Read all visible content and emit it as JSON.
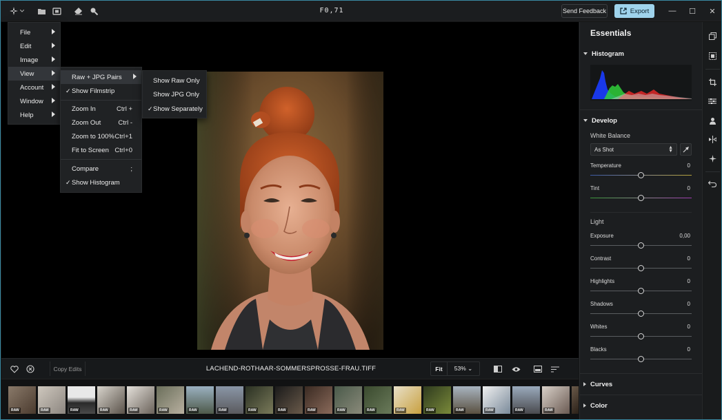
{
  "titlebar": {
    "title": "F0,71",
    "feedback_label": "Send Feedback",
    "export_label": "Export",
    "icons": [
      "app-logo-icon",
      "folder-icon",
      "import-icon",
      "eraser-icon",
      "search-icon"
    ],
    "window_controls": {
      "minimize": "—",
      "maximize": "☐",
      "close": "✕"
    }
  },
  "main_menu": {
    "items": [
      {
        "label": "File"
      },
      {
        "label": "Edit"
      },
      {
        "label": "Image"
      },
      {
        "label": "View"
      },
      {
        "label": "Account"
      },
      {
        "label": "Window"
      },
      {
        "label": "Help"
      }
    ]
  },
  "view_menu": {
    "raw_jpg": "Raw + JPG Pairs",
    "show_filmstrip": "Show Filmstrip",
    "zoom_in": {
      "label": "Zoom In",
      "shortcut": "Ctrl +"
    },
    "zoom_out": {
      "label": "Zoom Out",
      "shortcut": "Ctrl -"
    },
    "zoom_100": {
      "label": "Zoom to 100%",
      "shortcut": "Ctrl+1"
    },
    "fit_screen": {
      "label": "Fit to Screen",
      "shortcut": "Ctrl+0"
    },
    "compare": {
      "label": "Compare",
      "shortcut": ";"
    },
    "show_histogram": "Show Histogram"
  },
  "raw_submenu": {
    "raw_only": "Show Raw Only",
    "jpg_only": "Show JPG Only",
    "separately": "Show Separately"
  },
  "bottombar": {
    "copy_edits": "Copy Edits",
    "filename": "LACHEND-ROTHAAR-SOMMERSPROSSE-FRAU.TIFF",
    "fit_label": "Fit",
    "zoom_label": "53% ⌄"
  },
  "filmstrip": {
    "badge": "RAW"
  },
  "panel": {
    "title": "Essentials",
    "histogram_label": "Histogram",
    "develop_label": "Develop",
    "white_balance_label": "White Balance",
    "wb_value": "As Shot",
    "temperature": {
      "label": "Temperature",
      "value": "0"
    },
    "tint": {
      "label": "Tint",
      "value": "0"
    },
    "light_label": "Light",
    "exposure": {
      "label": "Exposure",
      "value": "0,00"
    },
    "contrast": {
      "label": "Contrast",
      "value": "0"
    },
    "highlights": {
      "label": "Highlights",
      "value": "0"
    },
    "shadows": {
      "label": "Shadows",
      "value": "0"
    },
    "whites": {
      "label": "Whites",
      "value": "0"
    },
    "blacks": {
      "label": "Blacks",
      "value": "0"
    },
    "curves_label": "Curves",
    "color_label": "Color"
  },
  "colors": {
    "accent": "#9fd3ec",
    "border": "#3a8aa3",
    "panel_bg": "#1c1e20"
  }
}
